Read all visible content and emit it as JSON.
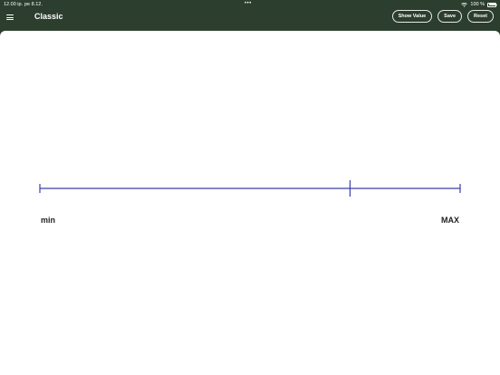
{
  "status_bar": {
    "time": "12.00 ip.",
    "date": "pe 8.12.",
    "dots": "•••",
    "battery_text": "100 %"
  },
  "nav": {
    "title": "Classic",
    "buttons": {
      "show_value": "Show Value",
      "save": "Save",
      "reset": "Reset"
    }
  },
  "scale": {
    "min_label": "min",
    "max_label": "MAX",
    "value_fraction": 0.738,
    "line_color": "#3a3fa8"
  },
  "colors": {
    "header_bg": "#2c3e2d",
    "content_bg": "#ffffff"
  }
}
